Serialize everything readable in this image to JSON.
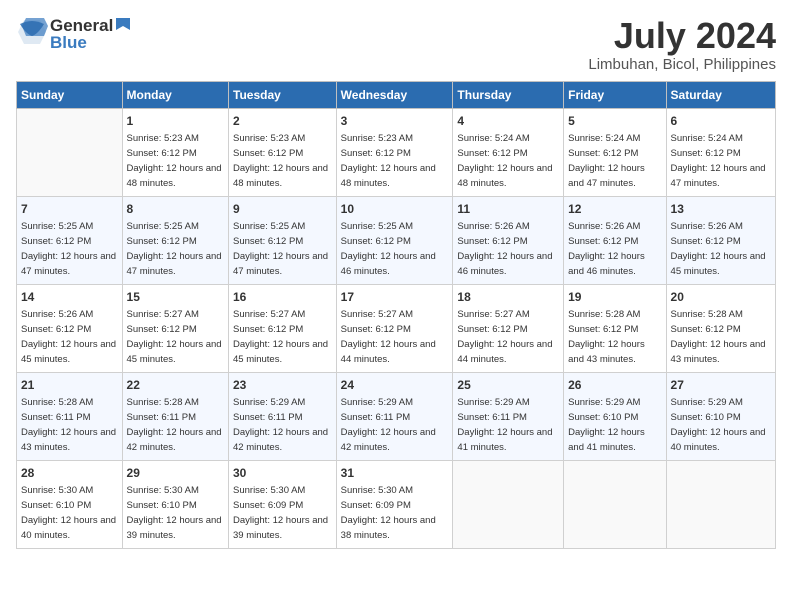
{
  "header": {
    "logo": {
      "general": "General",
      "blue": "Blue"
    },
    "month": "July 2024",
    "location": "Limbuhan, Bicol, Philippines"
  },
  "weekdays": [
    "Sunday",
    "Monday",
    "Tuesday",
    "Wednesday",
    "Thursday",
    "Friday",
    "Saturday"
  ],
  "weeks": [
    [
      {
        "day": null
      },
      {
        "day": 1,
        "sunrise": "5:23 AM",
        "sunset": "6:12 PM",
        "daylight": "12 hours and 48 minutes."
      },
      {
        "day": 2,
        "sunrise": "5:23 AM",
        "sunset": "6:12 PM",
        "daylight": "12 hours and 48 minutes."
      },
      {
        "day": 3,
        "sunrise": "5:23 AM",
        "sunset": "6:12 PM",
        "daylight": "12 hours and 48 minutes."
      },
      {
        "day": 4,
        "sunrise": "5:24 AM",
        "sunset": "6:12 PM",
        "daylight": "12 hours and 48 minutes."
      },
      {
        "day": 5,
        "sunrise": "5:24 AM",
        "sunset": "6:12 PM",
        "daylight": "12 hours and 47 minutes."
      },
      {
        "day": 6,
        "sunrise": "5:24 AM",
        "sunset": "6:12 PM",
        "daylight": "12 hours and 47 minutes."
      }
    ],
    [
      {
        "day": 7,
        "sunrise": "5:25 AM",
        "sunset": "6:12 PM",
        "daylight": "12 hours and 47 minutes."
      },
      {
        "day": 8,
        "sunrise": "5:25 AM",
        "sunset": "6:12 PM",
        "daylight": "12 hours and 47 minutes."
      },
      {
        "day": 9,
        "sunrise": "5:25 AM",
        "sunset": "6:12 PM",
        "daylight": "12 hours and 47 minutes."
      },
      {
        "day": 10,
        "sunrise": "5:25 AM",
        "sunset": "6:12 PM",
        "daylight": "12 hours and 46 minutes."
      },
      {
        "day": 11,
        "sunrise": "5:26 AM",
        "sunset": "6:12 PM",
        "daylight": "12 hours and 46 minutes."
      },
      {
        "day": 12,
        "sunrise": "5:26 AM",
        "sunset": "6:12 PM",
        "daylight": "12 hours and 46 minutes."
      },
      {
        "day": 13,
        "sunrise": "5:26 AM",
        "sunset": "6:12 PM",
        "daylight": "12 hours and 45 minutes."
      }
    ],
    [
      {
        "day": 14,
        "sunrise": "5:26 AM",
        "sunset": "6:12 PM",
        "daylight": "12 hours and 45 minutes."
      },
      {
        "day": 15,
        "sunrise": "5:27 AM",
        "sunset": "6:12 PM",
        "daylight": "12 hours and 45 minutes."
      },
      {
        "day": 16,
        "sunrise": "5:27 AM",
        "sunset": "6:12 PM",
        "daylight": "12 hours and 45 minutes."
      },
      {
        "day": 17,
        "sunrise": "5:27 AM",
        "sunset": "6:12 PM",
        "daylight": "12 hours and 44 minutes."
      },
      {
        "day": 18,
        "sunrise": "5:27 AM",
        "sunset": "6:12 PM",
        "daylight": "12 hours and 44 minutes."
      },
      {
        "day": 19,
        "sunrise": "5:28 AM",
        "sunset": "6:12 PM",
        "daylight": "12 hours and 43 minutes."
      },
      {
        "day": 20,
        "sunrise": "5:28 AM",
        "sunset": "6:12 PM",
        "daylight": "12 hours and 43 minutes."
      }
    ],
    [
      {
        "day": 21,
        "sunrise": "5:28 AM",
        "sunset": "6:11 PM",
        "daylight": "12 hours and 43 minutes."
      },
      {
        "day": 22,
        "sunrise": "5:28 AM",
        "sunset": "6:11 PM",
        "daylight": "12 hours and 42 minutes."
      },
      {
        "day": 23,
        "sunrise": "5:29 AM",
        "sunset": "6:11 PM",
        "daylight": "12 hours and 42 minutes."
      },
      {
        "day": 24,
        "sunrise": "5:29 AM",
        "sunset": "6:11 PM",
        "daylight": "12 hours and 42 minutes."
      },
      {
        "day": 25,
        "sunrise": "5:29 AM",
        "sunset": "6:11 PM",
        "daylight": "12 hours and 41 minutes."
      },
      {
        "day": 26,
        "sunrise": "5:29 AM",
        "sunset": "6:10 PM",
        "daylight": "12 hours and 41 minutes."
      },
      {
        "day": 27,
        "sunrise": "5:29 AM",
        "sunset": "6:10 PM",
        "daylight": "12 hours and 40 minutes."
      }
    ],
    [
      {
        "day": 28,
        "sunrise": "5:30 AM",
        "sunset": "6:10 PM",
        "daylight": "12 hours and 40 minutes."
      },
      {
        "day": 29,
        "sunrise": "5:30 AM",
        "sunset": "6:10 PM",
        "daylight": "12 hours and 39 minutes."
      },
      {
        "day": 30,
        "sunrise": "5:30 AM",
        "sunset": "6:09 PM",
        "daylight": "12 hours and 39 minutes."
      },
      {
        "day": 31,
        "sunrise": "5:30 AM",
        "sunset": "6:09 PM",
        "daylight": "12 hours and 38 minutes."
      },
      {
        "day": null
      },
      {
        "day": null
      },
      {
        "day": null
      }
    ]
  ]
}
